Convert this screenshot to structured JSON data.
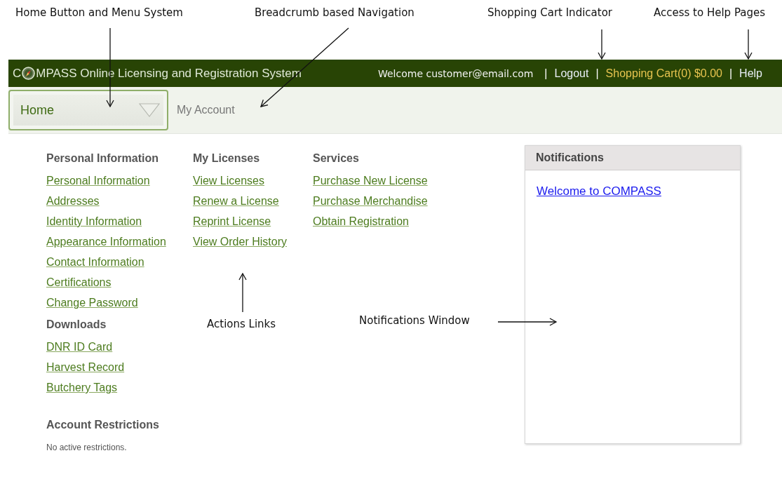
{
  "annotations": [
    {
      "text": "Home Button and Menu System"
    },
    {
      "text": "Breadcrumb based Navigation"
    },
    {
      "text": "Shopping Cart Indicator"
    },
    {
      "text": "Access to Help Pages"
    },
    {
      "text": "Actions Links"
    },
    {
      "text": "Notifications Window"
    }
  ],
  "header": {
    "logo_before": "C",
    "logo_after": "MPASS Online Licensing and Registration System",
    "welcome": "Welcome customer@email.com",
    "links": [
      {
        "separator": "|",
        "label": "Logout",
        "kind": "plain"
      },
      {
        "separator": "|",
        "label": "Shopping Cart(0) $0.00",
        "kind": "cart"
      },
      {
        "separator": "|",
        "label": "Help",
        "kind": "plain"
      }
    ]
  },
  "breadcrumb": {
    "home": "Home",
    "items": [
      "My Account"
    ]
  },
  "columns": [
    {
      "sections": [
        {
          "title": "Personal Information",
          "links": [
            "Personal Information",
            "Addresses",
            "Identity Information",
            "Appearance Information",
            "Contact Information",
            "Certifications",
            "Change Password"
          ]
        },
        {
          "title": "Downloads",
          "links": [
            "DNR ID Card",
            "Harvest Record",
            "Butchery Tags"
          ]
        },
        {
          "title": "Account Restrictions",
          "note": "No active restrictions."
        }
      ]
    },
    {
      "sections": [
        {
          "title": "My Licenses",
          "links": [
            "View Licenses",
            "Renew a License",
            "Reprint License",
            "View Order History"
          ]
        }
      ]
    },
    {
      "sections": [
        {
          "title": "Services",
          "links": [
            "Purchase New License",
            "Purchase Merchandise",
            "Obtain Registration"
          ]
        }
      ]
    }
  ],
  "notifications": {
    "title": "Notifications",
    "items": [
      "Welcome to COMPASS"
    ]
  }
}
